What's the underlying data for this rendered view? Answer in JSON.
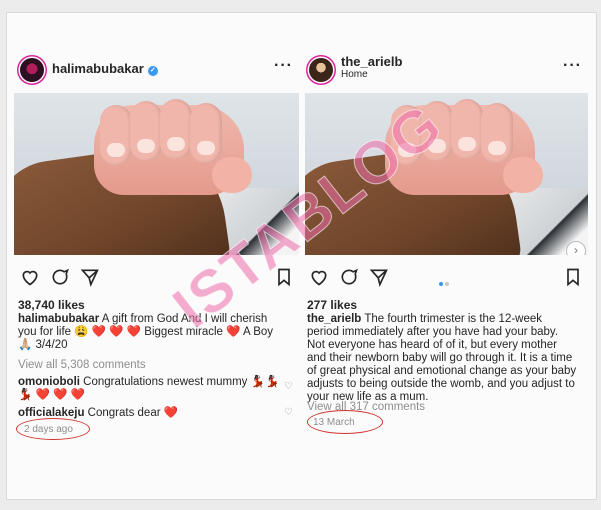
{
  "left_post": {
    "username": "halimabubakar",
    "likes": "38,740 likes",
    "caption_user": "halimabubakar",
    "caption_text": "A gift from God And I will cherish you for life 😩 ❤️ ❤️ ❤️ Biggest miracle ❤️ A Boy 🙏🏼 3/4/20",
    "view_all": "View all 5,308 comments",
    "comments": [
      {
        "user": "omonioboli",
        "text": "Congratulations newest mummy 💃🏿💃🏿💃🏿 ❤️ ❤️ ❤️"
      },
      {
        "user": "officialakeju",
        "text": "Congrats dear ❤️"
      }
    ],
    "time": "2 days ago"
  },
  "right_post": {
    "username": "the_arielb",
    "sublabel": "Home",
    "likes": "277 likes",
    "caption_user": "the_arielb",
    "caption_text": "The fourth trimester is the 12-week period immediately after you have had your baby. Not everyone has heard of of it, but every mother and their newborn baby will go through it. It is a time of great physical and emotional change as your baby adjusts to being outside the womb, and you adjust to your new life as a mum.",
    "view_all": "View all 317 comments",
    "time": "13 March"
  },
  "watermark": "ISTABLOG",
  "colors": {
    "verified": "#3897f0",
    "annotation": "#d1362f",
    "watermark": "#ec6caa"
  }
}
